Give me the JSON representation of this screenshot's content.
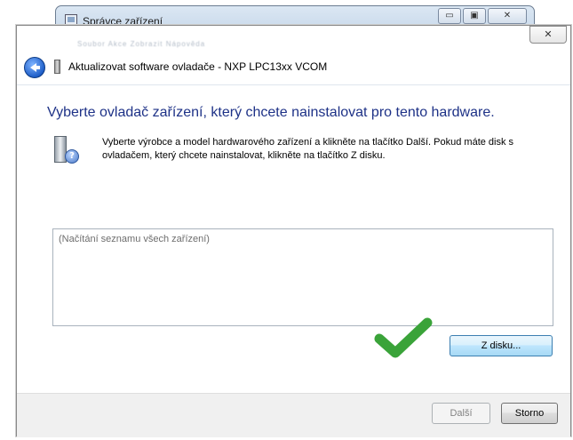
{
  "background_window": {
    "title": "Správce zařízení",
    "controls": [
      "▭",
      "▣",
      "✕"
    ]
  },
  "dialog": {
    "menu_blurred": "Soubor   Akce   Zobrazit   Nápověda",
    "close_label": "✕",
    "title": "Aktualizovat software ovladače - NXP LPC13xx VCOM",
    "heading": "Vyberte ovladač zařízení, který chcete nainstalovat pro tento hardware.",
    "instruction": "Vyberte výrobce a model hardwarového zařízení a klikněte na tlačítko Další. Pokud máte disk s ovladačem, který chcete nainstalovat, klikněte na tlačítko Z disku.",
    "list_placeholder": "(Načítání seznamu všech zařízení)",
    "have_disk_button": "Z disku...",
    "next_button": "Další",
    "cancel_button": "Storno"
  },
  "colors": {
    "heading": "#1e3287",
    "checkmark": "#3aa339"
  },
  "icons": {
    "back": "back-arrow-icon",
    "device": "device-icon",
    "hardware_help": "hardware-question-icon",
    "checkmark": "checkmark-icon"
  }
}
